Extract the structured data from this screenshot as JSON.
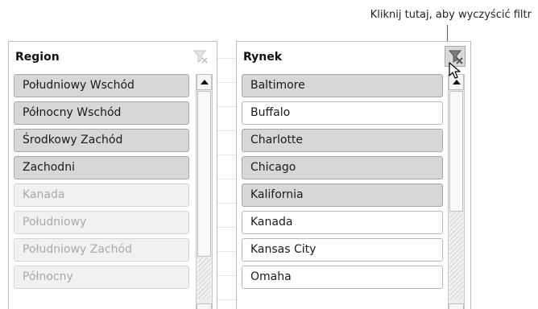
{
  "callout": {
    "text": "Kliknij tutaj, aby wyczyścić filtr"
  },
  "region_slicer": {
    "title": "Region",
    "items": [
      {
        "label": "Południowy Wschód",
        "state": "selected"
      },
      {
        "label": "Północny Wschód",
        "state": "selected"
      },
      {
        "label": "Środkowy Zachód",
        "state": "selected"
      },
      {
        "label": "Zachodni",
        "state": "selected"
      },
      {
        "label": "Kanada",
        "state": "nodata"
      },
      {
        "label": "Południowy",
        "state": "nodata"
      },
      {
        "label": "Południowy Zachód",
        "state": "nodata"
      },
      {
        "label": "Północny",
        "state": "nodata"
      }
    ]
  },
  "rynek_slicer": {
    "title": "Rynek",
    "items": [
      {
        "label": "Baltimore",
        "state": "selected"
      },
      {
        "label": "Buffalo",
        "state": "plain"
      },
      {
        "label": "Charlotte",
        "state": "selected"
      },
      {
        "label": "Chicago",
        "state": "selected"
      },
      {
        "label": "Kalifornia",
        "state": "selected"
      },
      {
        "label": "Kanada",
        "state": "plain"
      },
      {
        "label": "Kansas City",
        "state": "plain"
      },
      {
        "label": "Omaha",
        "state": "plain"
      }
    ]
  },
  "icons": {
    "clear_filter": "clear-filter-icon",
    "scroll_up": "scroll-up-arrow-icon",
    "scroll_down": "scroll-down-arrow-icon",
    "cursor": "mouse-pointer-icon"
  },
  "colors": {
    "selected_item": "#d7d7d7",
    "nodata_item": "#f1f1f1",
    "nodata_text": "#a9a9a9",
    "active_clear_button": "#d9d9d9"
  }
}
